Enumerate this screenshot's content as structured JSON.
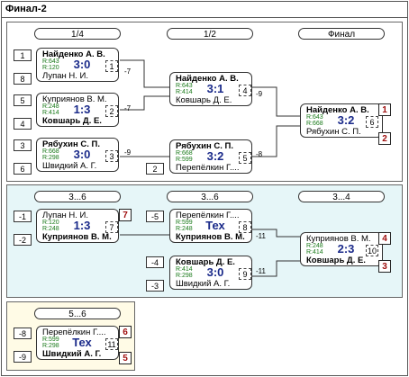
{
  "title": "Финал-2",
  "colors": {
    "main_bg": "#ffffff",
    "consolation_bg": "#e6f6f8",
    "fifth_bg": "#fffbe6",
    "score": "#1a2a8a",
    "rating": "#1a7a1a",
    "place": "#a01010"
  },
  "sections": {
    "main": {
      "stages": [
        "1/4",
        "1/2",
        "Финал"
      ]
    },
    "places_3_6": {
      "stages": [
        "3...6",
        "3...6",
        "3...4"
      ]
    },
    "places_5_6": {
      "stages": [
        "5...6"
      ]
    }
  },
  "seeds": [
    "1",
    "8",
    "5",
    "4",
    "3",
    "6",
    "2",
    "-1",
    "-2",
    "-5",
    "-4",
    "-3",
    "-8",
    "-9"
  ],
  "matches": [
    {
      "p1": "Найденко А. В.",
      "p2": "Лупан Н. И.",
      "r1": "R:643",
      "r2": "R:120",
      "score": "3:0",
      "num": "1",
      "win": 1
    },
    {
      "p1": "Куприянов В. М.",
      "p2": "Ковшарь Д. Е.",
      "r1": "R:248",
      "r2": "R:414",
      "score": "1:3",
      "num": "2",
      "win": 2
    },
    {
      "p1": "Рябухин С. П.",
      "p2": "Швидкий А. Г.",
      "r1": "R:668",
      "r2": "R:298",
      "score": "3:0",
      "num": "3",
      "win": 1
    },
    {
      "p1": "Найденко А. В.",
      "p2": "Ковшарь Д. Е.",
      "r1": "R:643",
      "r2": "R:414",
      "score": "3:1",
      "num": "4",
      "win": 1
    },
    {
      "p1": "Рябухин С. П.",
      "p2": "Перепёлкин Г....",
      "r1": "R:668",
      "r2": "R:599",
      "score": "3:2",
      "num": "5",
      "win": 1
    },
    {
      "p1": "Найденко А. В.",
      "p2": "Рябухин С. П.",
      "r1": "R:643",
      "r2": "R:668",
      "score": "3:2",
      "num": "6",
      "win": 1
    },
    {
      "p1": "Лупан Н. И.",
      "p2": "Куприянов В. М.",
      "r1": "R:120",
      "r2": "R:248",
      "score": "1:3",
      "num": "7",
      "win": 2
    },
    {
      "p1": "Перепёлкин Г....",
      "p2": "Куприянов В. М.",
      "r1": "R:599",
      "r2": "R:248",
      "score": "Тех",
      "num": "8",
      "win": 2
    },
    {
      "p1": "Ковшарь Д. Е.",
      "p2": "Швидкий А. Г.",
      "r1": "R:414",
      "r2": "R:298",
      "score": "3:0",
      "num": "9",
      "win": 1
    },
    {
      "p1": "Куприянов В. М.",
      "p2": "Ковшарь Д. Е.",
      "r1": "R:248",
      "r2": "R:414",
      "score": "2:3",
      "num": "10",
      "win": 2
    },
    {
      "p1": "Перепёлкин Г....",
      "p2": "Швидкий А. Г.",
      "r1": "R:599",
      "r2": "R:298",
      "score": "Тех",
      "num": "11",
      "win": 2
    }
  ],
  "places": [
    "1",
    "2",
    "7",
    "4",
    "3",
    "6",
    "5"
  ],
  "loser_refs": [
    "-7",
    "-7",
    "-9",
    "-9",
    "-8",
    "-11",
    "-11"
  ]
}
